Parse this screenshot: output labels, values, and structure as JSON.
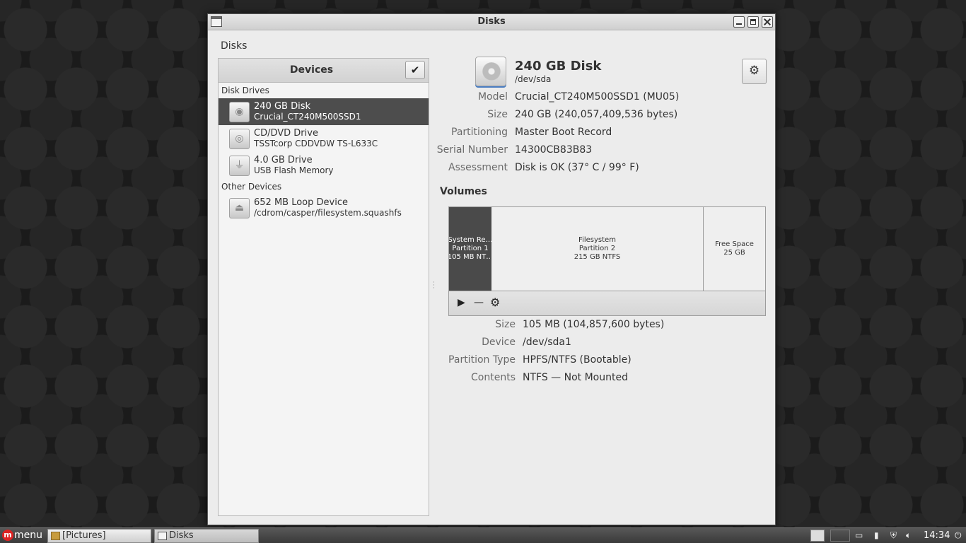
{
  "window": {
    "title": "Disks",
    "header": "Disks"
  },
  "sidebar": {
    "title": "Devices",
    "check_icon": "checkmark-icon",
    "groups": [
      {
        "label": "Disk Drives",
        "devices": [
          {
            "name": "240 GB Disk",
            "sub": "Crucial_CT240M500SSD1",
            "icon": "harddisk-icon",
            "selected": true
          },
          {
            "name": "CD/DVD Drive",
            "sub": "TSSTcorp CDDVDW TS-L633C",
            "icon": "optical-drive-icon",
            "selected": false
          },
          {
            "name": "4.0 GB Drive",
            "sub": "USB Flash Memory",
            "icon": "usb-icon",
            "selected": false
          }
        ]
      },
      {
        "label": "Other Devices",
        "devices": [
          {
            "name": "652 MB Loop Device",
            "sub": "/cdrom/casper/filesystem.squashfs",
            "icon": "eject-icon",
            "selected": false
          }
        ]
      }
    ]
  },
  "disk": {
    "title": "240 GB Disk",
    "path": "/dev/sda",
    "props": [
      {
        "key": "Model",
        "value": "Crucial_CT240M500SSD1 (MU05)"
      },
      {
        "key": "Size",
        "value": "240 GB (240,057,409,536 bytes)"
      },
      {
        "key": "Partitioning",
        "value": "Master Boot Record"
      },
      {
        "key": "Serial Number",
        "value": "14300CB83B83"
      },
      {
        "key": "Assessment",
        "value": "Disk is OK (37° C / 99° F)"
      }
    ]
  },
  "volumes": {
    "title": "Volumes",
    "partitions": [
      {
        "line1": "System Re…",
        "line2": "Partition 1",
        "line3": "105 MB NT…"
      },
      {
        "line1": "Filesystem",
        "line2": "Partition 2",
        "line3": "215 GB NTFS"
      },
      {
        "line1": "Free Space",
        "line2": "25 GB"
      }
    ],
    "toolbar": {
      "play": "▶",
      "minus": "—",
      "gear": "⚙"
    },
    "props": [
      {
        "key": "Size",
        "value": "105 MB (104,857,600 bytes)"
      },
      {
        "key": "Device",
        "value": "/dev/sda1"
      },
      {
        "key": "Partition Type",
        "value": "HPFS/NTFS (Bootable)"
      },
      {
        "key": "Contents",
        "value": "NTFS — Not Mounted"
      }
    ]
  },
  "taskbar": {
    "menu_label": "menu",
    "tasks": [
      {
        "label": "[Pictures]"
      },
      {
        "label": "Disks"
      }
    ],
    "clock": "14:34"
  }
}
